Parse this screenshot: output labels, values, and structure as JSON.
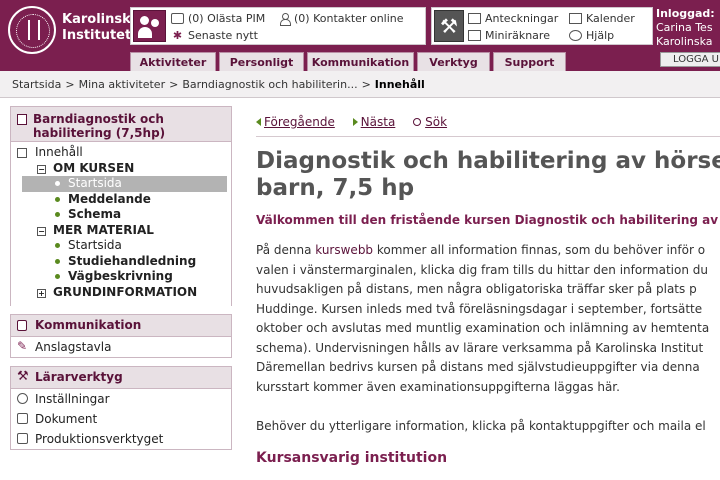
{
  "header": {
    "logo_lines": [
      "Karolinska",
      "Institutet"
    ],
    "pim": {
      "unread": "(0) Olästa PIM",
      "contacts_online": "(0) Kontakter online",
      "latest": "Senaste nytt"
    },
    "tools": {
      "notes": "Anteckningar",
      "calendar": "Kalender",
      "calculator": "Miniräknare",
      "help": "Hjälp"
    },
    "login": {
      "heading": "Inloggad:",
      "name": "Carina Tes",
      "org": "Karolinska",
      "logout": "LOGGA U"
    },
    "nav_tabs": [
      "Aktiviteter",
      "Personligt",
      "Kommunikation",
      "Verktyg",
      "Support"
    ]
  },
  "breadcrumb": {
    "items": [
      "Startsida",
      "Mina aktiviteter",
      "Barndiagnostik och habiliterin..."
    ],
    "current": "Innehåll",
    "separator": ">"
  },
  "sidebar": {
    "course_title": "Barndiagnostik och habilitering (7,5hp)",
    "contents": "Innehåll",
    "groups": [
      {
        "label": "OM KURSEN",
        "expanded": true,
        "items": [
          "Startsida",
          "Meddelande",
          "Schema"
        ]
      },
      {
        "label": "MER MATERIAL",
        "expanded": true,
        "items": [
          "Startsida",
          "Studiehandledning",
          "Vägbeskrivning"
        ]
      },
      {
        "label": "GRUNDINFORMATION",
        "expanded": false,
        "items": []
      }
    ],
    "active_item": "Startsida",
    "communication": {
      "title": "Kommunikation",
      "items": [
        "Anslagstavla"
      ]
    },
    "teacher_tools": {
      "title": "Lärarverktyg",
      "items": [
        "Inställningar",
        "Dokument",
        "Produktionsverktyget"
      ]
    }
  },
  "main": {
    "pager": {
      "prev": "Föregående",
      "next": "Nästa",
      "search": "Sök"
    },
    "title_lines": [
      "Diagnostik och habilitering av hörse",
      "barn, 7,5 hp"
    ],
    "intro": "Välkommen till den fristående kursen Diagnostik och habilitering av hö",
    "paragraph": {
      "before_link": "På denna ",
      "link": "kurswebb",
      "after_link": " kommer all information finnas, som du behöver inför o",
      "lines": [
        "valen i vänstermarginalen, klicka dig fram tills du hittar den information du",
        "huvudsakligen på distans, men några obligatoriska träffar sker på plats p",
        "Huddinge. Kursen inleds med två föreläsningsdagar i september, fortsätte",
        "oktober och avslutas med muntlig examination och inlämning av hemtenta",
        "schema). Undervisningen hålls av lärare verksamma på Karolinska Institut",
        "Däremellan bedrivs kursen på distans med självstudieuppgifter via denna",
        "kursstart kommer även examinationsuppgifterna läggas här."
      ]
    },
    "paragraph2": "Behöver du ytterligare information, klicka på kontaktuppgifter och maila el",
    "subheading": "Kursansvarig institution"
  },
  "colors": {
    "brand": "#7b1f4f",
    "accent_green": "#5a8a1f"
  }
}
